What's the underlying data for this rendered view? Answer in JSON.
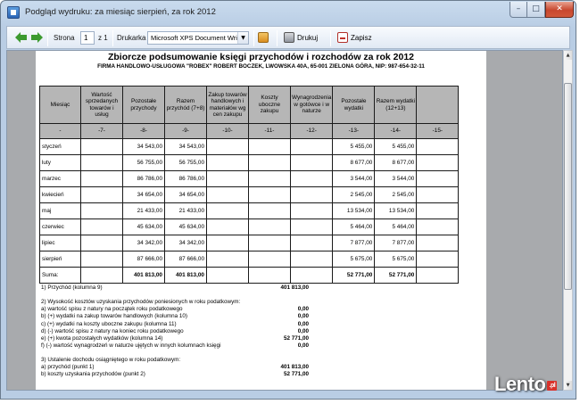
{
  "window": {
    "title": "Podgląd wydruku: za miesiąc sierpień, za rok 2012",
    "controls": {
      "minimize": "–",
      "maximize": "□",
      "close": "✕"
    }
  },
  "toolbar": {
    "page_label": "Strona",
    "page_value": "1",
    "page_of": "z 1",
    "printer_label": "Drukarka",
    "printer_value": "Microsoft XPS Document Writer",
    "print_label": "Drukuj",
    "close_label": "Zapisz"
  },
  "document": {
    "title": "Zbiorcze podsumowanie księgi przychodów i rozchodów za rok 2012",
    "company": "FIRMA HANDLOWO-USŁUGOWA \"ROBEX\" ROBERT BOCZEK, LWOWSKA 40A, 65-001 ZIELONA GÓRA, NIP: 987-654-32-11",
    "table": {
      "headers": [
        "Miesiąc",
        "Wartość sprzedanych towarów i usług",
        "Pozostałe przychody",
        "Razem przychód (7+8)",
        "Zakup towarów handlowych i materiałów wg cen zakupu",
        "Koszty uboczne zakupu",
        "Wynagrodzenia w gotówce i w naturze",
        "Pozostałe wydatki",
        "Razem wydatki (12+13)",
        ""
      ],
      "column_numbers": [
        "-",
        "-7-",
        "-8-",
        "-9-",
        "-10-",
        "-11-",
        "-12-",
        "-13-",
        "-14-",
        "-15-"
      ],
      "rows": [
        [
          "styczeń",
          "",
          "34 543,00",
          "34 543,00",
          "",
          "",
          "",
          "5 455,00",
          "5 455,00",
          ""
        ],
        [
          "luty",
          "",
          "56 755,00",
          "56 755,00",
          "",
          "",
          "",
          "8 677,00",
          "8 677,00",
          ""
        ],
        [
          "marzec",
          "",
          "86 786,00",
          "86 786,00",
          "",
          "",
          "",
          "3 544,00",
          "3 544,00",
          ""
        ],
        [
          "kwiecień",
          "",
          "34 654,00",
          "34 654,00",
          "",
          "",
          "",
          "2 545,00",
          "2 545,00",
          ""
        ],
        [
          "maj",
          "",
          "21 433,00",
          "21 433,00",
          "",
          "",
          "",
          "13 534,00",
          "13 534,00",
          ""
        ],
        [
          "czerwiec",
          "",
          "45 634,00",
          "45 634,00",
          "",
          "",
          "",
          "5 464,00",
          "5 464,00",
          ""
        ],
        [
          "lipiec",
          "",
          "34 342,00",
          "34 342,00",
          "",
          "",
          "",
          "7 877,00",
          "7 877,00",
          ""
        ],
        [
          "sierpień",
          "",
          "87 666,00",
          "87 666,00",
          "",
          "",
          "",
          "5 675,00",
          "5 675,00",
          ""
        ]
      ],
      "sum_row": [
        "Suma:",
        "",
        "401 813,00",
        "401 813,00",
        "",
        "",
        "",
        "52 771,00",
        "52 771,00",
        ""
      ]
    },
    "summary": [
      {
        "text": "1) Przychód (kolumna 9)",
        "value": "401 813,00"
      },
      {
        "text": "",
        "value": ""
      },
      {
        "text": "2) Wysokość kosztów uzyskania przychodów poniesionych w roku podatkowym:",
        "value": ""
      },
      {
        "text": "a) wartość spisu z natury na początek roku podatkowego",
        "value": "0,00"
      },
      {
        "text": "b) (+) wydatki na zakup towarów handlowych (kolumna 10)",
        "value": "0,00"
      },
      {
        "text": "c) (+) wydatki na koszty uboczne zakupu (kolumna 11)",
        "value": "0,00"
      },
      {
        "text": "d) (-) wartość spisu z natury na koniec roku podatkowego",
        "value": "0,00"
      },
      {
        "text": "e) (+) kwota pozostałych wydatków (kolumna 14)",
        "value": "52 771,00"
      },
      {
        "text": "f) (-) wartość wynagrodzeń w naturze ujętych w innych kolumnach księgi",
        "value": "0,00"
      },
      {
        "text": "",
        "value": ""
      },
      {
        "text": "3) Ustalenie dochodu osiągniętego w roku podatkowym:",
        "value": ""
      },
      {
        "text": "a) przychód (punkt 1)",
        "value": "401 813,00"
      },
      {
        "text": "b) koszty uzyskania przychodów (punkt 2)",
        "value": "52 771,00"
      }
    ]
  },
  "watermark": {
    "text": "Lento",
    "badge": ".pl"
  }
}
